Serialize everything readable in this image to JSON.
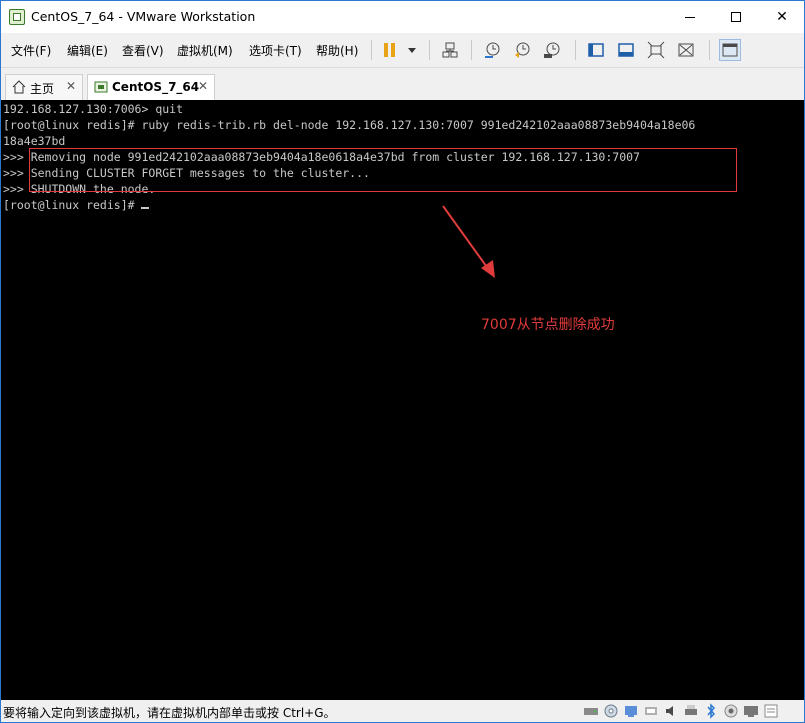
{
  "window": {
    "title": "CentOS_7_64 - VMware Workstation"
  },
  "menu": [
    {
      "label": "文件(F)"
    },
    {
      "label": "编辑(E)"
    },
    {
      "label": "查看(V)"
    },
    {
      "label": "虚拟机(M)"
    },
    {
      "label": "选项卡(T)"
    },
    {
      "label": "帮助(H)"
    }
  ],
  "tabs": [
    {
      "label": "主页",
      "icon": "home-icon"
    },
    {
      "label": "CentOS_7_64",
      "icon": "vm-icon"
    }
  ],
  "console": {
    "line1": "192.168.127.130:7006> quit",
    "line2": "[root@linux redis]# ruby redis-trib.rb del-node 192.168.127.130:7007 991ed242102aaa08873eb9404a18e06",
    "line3": "18a4e37bd",
    "line4": ">>> Removing node 991ed242102aaa08873eb9404a18e0618a4e37bd from cluster 192.168.127.130:7007",
    "line5": ">>> Sending CLUSTER FORGET messages to the cluster...",
    "line6": ">>> SHUTDOWN the node.",
    "line7": "[root@linux redis]# "
  },
  "annotation": {
    "text": "7007从节点删除成功",
    "color": "#e23b3b"
  },
  "statusbar": {
    "text": "要将输入定向到该虚拟机，请在虚拟机内部单击或按 Ctrl+G。"
  },
  "colors": {
    "accent": "#2b78d3",
    "highlight": "#e03c3c"
  }
}
